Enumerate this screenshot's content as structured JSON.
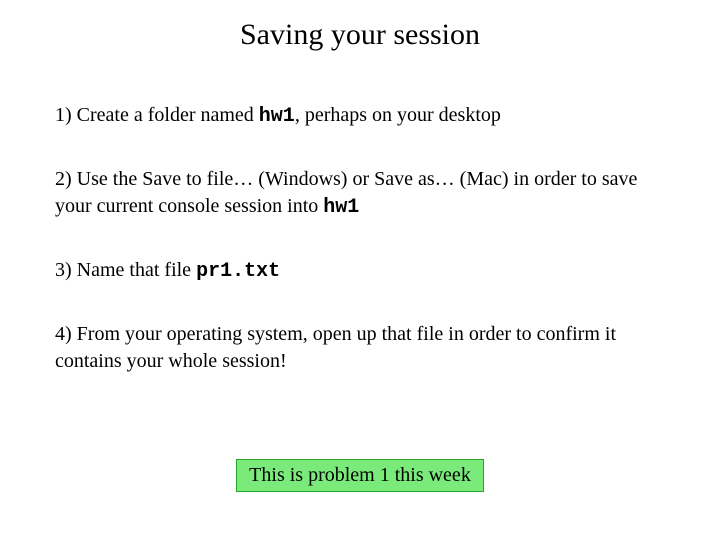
{
  "title": "Saving your session",
  "step1": {
    "prefix": "1) Create a folder named ",
    "code": "hw1",
    "suffix": ", perhaps on your desktop"
  },
  "step2": {
    "line1_prefix": "2) Use the Save to file… (Windows) or Save as… (Mac) in order to save your current console session into ",
    "code": "hw1"
  },
  "step3": {
    "prefix": "3) Name that file  ",
    "code": "pr1.txt"
  },
  "step4": {
    "text": "4) From your operating system,  open up that file in order to confirm it contains your whole session!"
  },
  "callout": "This is problem 1 this week"
}
